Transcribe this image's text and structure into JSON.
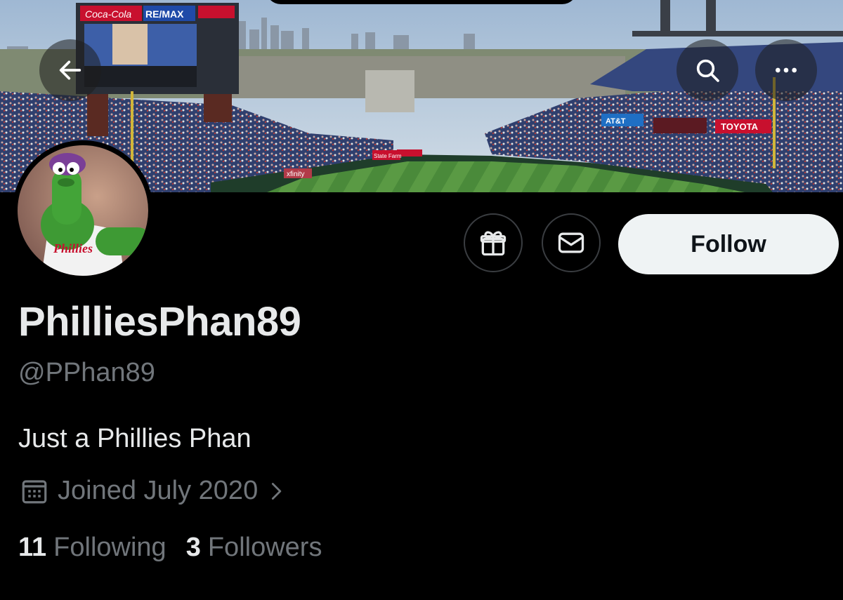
{
  "profile": {
    "display_name": "PhilliesPhan89",
    "handle": "@PPhan89",
    "bio": "Just a Phillies Phan",
    "joined": "Joined July 2020",
    "following_count": "11",
    "following_label": "Following",
    "followers_count": "3",
    "followers_label": "Followers"
  },
  "actions": {
    "follow_label": "Follow"
  },
  "banner": {
    "signs": [
      "Coca-Cola",
      "RE/MAX",
      "TOYOTA",
      "AT&T",
      "TOYOTA",
      "xfinity",
      "State Farm"
    ]
  },
  "icons": {
    "back": "arrow-left-icon",
    "search": "search-icon",
    "more": "more-horizontal-icon",
    "gift": "gift-icon",
    "mail": "envelope-icon",
    "calendar": "calendar-icon",
    "chevron": "chevron-right-icon"
  },
  "colors": {
    "background": "#000000",
    "primary_text": "#e7e9ea",
    "secondary_text": "#71767b",
    "follow_button_bg": "#eff3f4",
    "follow_button_text": "#0f1419",
    "border": "#3a3d41"
  }
}
